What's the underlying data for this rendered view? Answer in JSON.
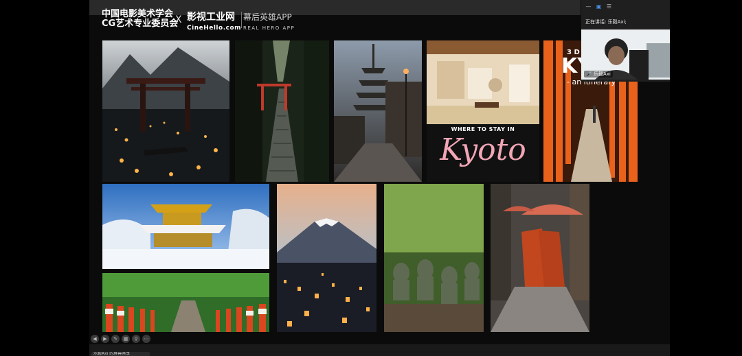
{
  "header": {
    "org_line1": "中国电影美术学会",
    "org_line2": "CG艺术专业委员会",
    "cross": "X",
    "brand_title": "影视工业网",
    "brand_url": "CineHello.com",
    "app_title": "幕后英雄APP",
    "app_subtitle": "REAL HERO APP"
  },
  "video_panel": {
    "speaking_label": "正在讲话: 乐毅Axi;",
    "participant_name": "乐毅Axi",
    "icons": [
      "minimize-icon",
      "layout-icon",
      "menu-icon"
    ]
  },
  "slide_texts": {
    "kyoto_where": "WHERE TO STAY IN",
    "kyoto_title": "Kyoto",
    "itinerary_number": "3 D",
    "itinerary_city": "KY",
    "itinerary_sub": "- an itinerary"
  },
  "controls": [
    "prev-icon",
    "next-icon",
    "pen-icon",
    "grid-icon",
    "zoom-icon",
    "more-icon"
  ],
  "bottom": {
    "label": "乐毅Axi 的屏幕共享"
  }
}
